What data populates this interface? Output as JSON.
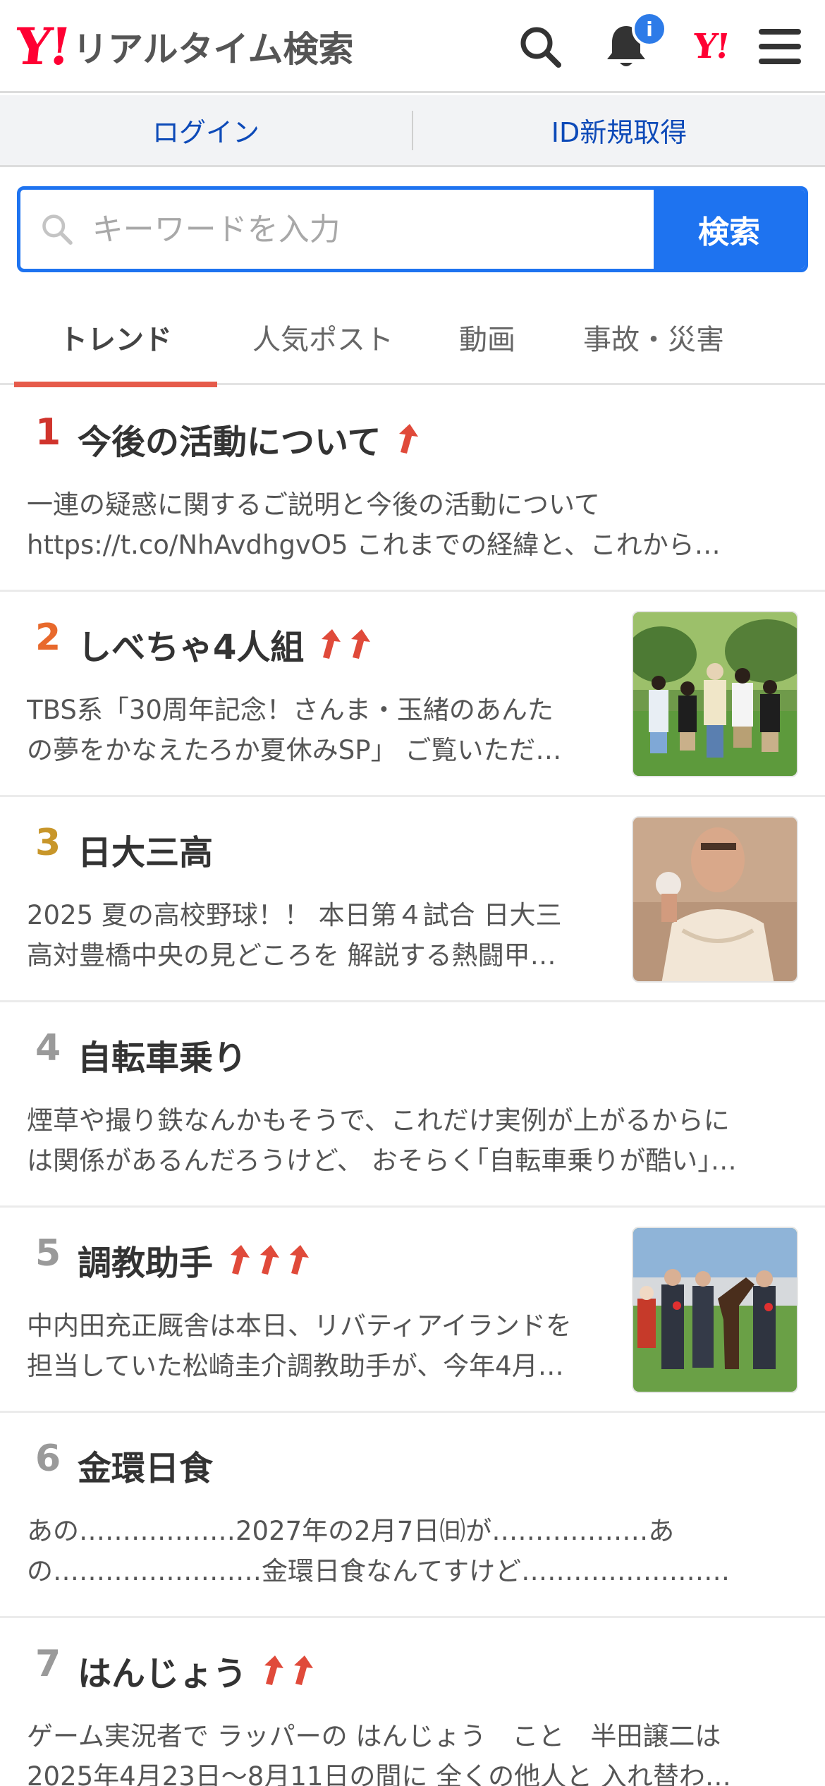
{
  "header": {
    "logo_mark": "Y!",
    "logo_text": "リアルタイム検索",
    "notification_badge": "i",
    "yahoo_mark": "Y!"
  },
  "account": {
    "login": "ログイン",
    "register": "ID新規取得"
  },
  "search": {
    "placeholder": "キーワードを入力",
    "button": "検索"
  },
  "tabs": [
    {
      "label": "トレンド",
      "active": true
    },
    {
      "label": "人気ポスト",
      "active": false
    },
    {
      "label": "動画",
      "active": false
    },
    {
      "label": "事故・災害",
      "active": false
    }
  ],
  "trends": [
    {
      "rank": "1",
      "rank_color": "#d0342c",
      "title": "今後の活動について",
      "arrows": 1,
      "desc_line1": "一連の疑惑に関するご説明と今後の活動について",
      "desc_line2": "https://t.co/NhAvdhgvO5 これまでの経緯と、これから…",
      "thumb": null
    },
    {
      "rank": "2",
      "rank_color": "#e8692c",
      "title": "しべちゃ4人組",
      "arrows": 2,
      "desc_line1": "TBS系「30周年記念！さんま・玉緒のあんた",
      "desc_line2": "の夢をかなえたろか夏休みSP」 ご覧いただ…",
      "thumb": "family-photo"
    },
    {
      "rank": "3",
      "rank_color": "#c8962a",
      "title": "日大三高",
      "arrows": 0,
      "desc_line1": "2025 夏の高校野球！！ 本日第４試合 日大三",
      "desc_line2": "高対豊橋中央の見どころを 解説する熱闘甲…",
      "thumb": "person-photo"
    },
    {
      "rank": "4",
      "rank_color": "#9a9a9a",
      "title": "自転車乗り",
      "arrows": 0,
      "desc_line1": "煙草や撮り鉄なんかもそうで、これだけ実例が上がるからに",
      "desc_line2": "は関係があるんだろうけど、 おそらく｢自転車乗りが酷い｣…",
      "thumb": null
    },
    {
      "rank": "5",
      "rank_color": "#9a9a9a",
      "title": "調教助手",
      "arrows": 3,
      "desc_line1": "中内田充正厩舎は本日、リバティアイランドを",
      "desc_line2": "担当していた松崎圭介調教助手が、今年4月…",
      "thumb": "horse-photo"
    },
    {
      "rank": "6",
      "rank_color": "#9a9a9a",
      "title": "金環日食",
      "arrows": 0,
      "desc_line1": "あの………………2027年の2月7日㈰が………………あ",
      "desc_line2": "の……………………金環日食なんてすけど……………………",
      "thumb": null
    },
    {
      "rank": "7",
      "rank_color": "#9a9a9a",
      "title": "はんじょう",
      "arrows": 2,
      "desc_line1": "ゲーム実況者で ラッパーの はんじょう　こと　半田譲二は",
      "desc_line2": "2025年4月23日〜8月11日の間に 全くの他人と 入れ替わ…",
      "thumb": null
    }
  ],
  "colors": {
    "accent_blue": "#1e73f0",
    "tab_underline": "#e65b4b",
    "brand_red": "#ff0033"
  }
}
